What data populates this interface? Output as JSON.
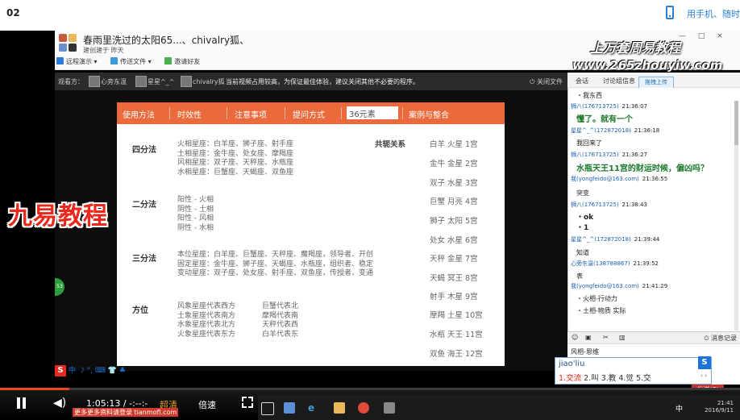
{
  "page": {
    "video_no": "02",
    "phone_watch": "用手机、随时"
  },
  "chat_window": {
    "title": "春雨里洗过的太阳65...、chivalry狐、",
    "subtitle": "建创建于 昨天",
    "toolbar": [
      "远程演示",
      "传送文件",
      "邀请好友"
    ],
    "controls": "— □ ×"
  },
  "share_bar": {
    "label": "观看方：",
    "viewers": [
      "心旁东温",
      "星星^_^",
      "chivalry狐"
    ],
    "notice": "当前视频占用较高，为保证最佳体验，建议关闭其他不必要的程序。",
    "close": "关闭文件"
  },
  "slide": {
    "tabs": [
      "使用方法",
      "时效性",
      "注意事项",
      "提问方式",
      "案例与整合"
    ],
    "tab_input": "36元素",
    "sections": {
      "sifenfa": {
        "title": "四分法",
        "lines": [
          "火相星座：白羊座、狮子座、射手座",
          "土相星座：金牛座、处女座、摩羯座",
          "风相星座：双子座、天秤座、水瓶座",
          "水相星座：巨蟹座、天蝎座、双鱼座"
        ]
      },
      "erfenfa": {
        "title": "二分法",
        "lines": [
          "阳性 - 火相",
          "阴性 - 土相",
          "阳性 - 风相",
          "阴性 - 水相"
        ]
      },
      "sanfenfa": {
        "title": "三分法",
        "lines": [
          "本位星座：白羊座、巨蟹座、天秤座、魔羯座，领导者、开创",
          "固定星座：金牛座、狮子座、天蝎座、水瓶座，组织者、稳定",
          "变动星座：双子座、处女座、射手座、双鱼座，传授者、变通"
        ]
      },
      "fangwei": {
        "title": "方位",
        "left": [
          "风象星座代表西方",
          "土象星座代表南方",
          "水象星座代表北方",
          "火象星座代表东方"
        ],
        "right": [
          "巨蟹代表北",
          "摩羯代表南",
          "天秤代表西",
          "白羊代表东"
        ]
      }
    },
    "gongtong": "共轭关系",
    "houses": [
      "白羊 火星 1宫",
      "金牛 金星 2宫",
      "双子 水星 3宫",
      "巨蟹 月亮 4宫",
      "狮子 太阳 5宫",
      "处女 水星 6宫",
      "天秤 金星 7宫",
      "天蝎 冥王 8宫",
      "射手 木星 9宫",
      "摩羯 土星 10宫",
      "水瓶 天王 11宫",
      "双鱼 海王 12宫"
    ]
  },
  "overlays": {
    "jiuyi": "九易教程",
    "logo1": "上万套周易教程",
    "logo2": "www.265zhouyiw.com",
    "green_badge": "53"
  },
  "chat": {
    "tabs": [
      "会话",
      "讨论组信息"
    ],
    "upload": "拖拽上传",
    "messages": [
      {
        "text": "・我东西",
        "style": "small"
      },
      {
        "nick": "狮八(176713725)",
        "time": "21:36:07"
      },
      {
        "text": "懂了。就有一个",
        "style": "big"
      },
      {
        "nick": "星星^_^(172872018)",
        "time": "21:36:18"
      },
      {
        "text": "我回来了",
        "style": "small"
      },
      {
        "nick": "狮八(176713725)",
        "time": "21:36:27"
      },
      {
        "text": "水瓶天王11宫的财运时候，偏凶吗？",
        "style": "big"
      },
      {
        "nick": "我(yongfeido@163.com)",
        "time": "21:36:55"
      },
      {
        "text": "突变",
        "style": "small"
      },
      {
        "nick": "狮八(176713725)",
        "time": "21:38:43"
      },
      {
        "text": "・ok",
        "style": "mid"
      },
      {
        "text": "・1",
        "style": "mid"
      },
      {
        "nick": "星星^_^(172872018)",
        "time": "21:39:44"
      },
      {
        "text": "知道",
        "style": "small"
      },
      {
        "nick": "心旁东温(138788867)",
        "time": "21:39:52"
      },
      {
        "text": "表",
        "style": "small"
      },
      {
        "nick": "我(yongfeido@163.com)",
        "time": "21:41:29"
      },
      {
        "text": "・火相-行动力",
        "style": "small"
      },
      {
        "text": "・土相-物质 实际",
        "style": "small"
      }
    ],
    "tools_right": "消息记录",
    "input_text": "风相-思维",
    "send": "发送(S)"
  },
  "ime": {
    "composition": "jiao'liu",
    "candidates": [
      "1.交流",
      "2.叫",
      "3.教",
      "4.觉",
      "5.交"
    ],
    "logo": "S"
  },
  "sogou_bar": "中 ☽ °, ⌨ 👕 ♣",
  "player": {
    "time": "1:05:13 / -:--:-",
    "quality": "超清",
    "speed": "倍速",
    "watermark": "更多更多资料请登录 tianmofl.com"
  },
  "taskbar": {
    "ime_lang": "中",
    "clock": "21:41",
    "date": "2016/9/11"
  }
}
